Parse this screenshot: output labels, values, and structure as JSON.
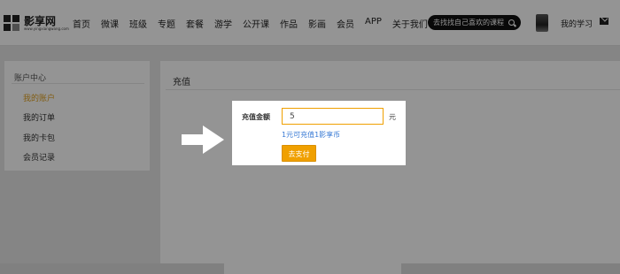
{
  "header": {
    "logo_text": "影享网",
    "logo_sub": "www.yingxiangwang.com",
    "nav": [
      "首页",
      "微课",
      "班级",
      "专题",
      "套餐",
      "游学",
      "公开课",
      "作品",
      "影画",
      "会员",
      "APP",
      "关于我们"
    ],
    "search_placeholder": "去找找自己喜欢的课程",
    "my_study": "我的学习"
  },
  "sidebar": {
    "title": "账户中心",
    "items": [
      {
        "label": "我的账户",
        "active": true
      },
      {
        "label": "我的订单",
        "active": false
      },
      {
        "label": "我的卡包",
        "active": false
      },
      {
        "label": "会员记录",
        "active": false
      }
    ]
  },
  "panel": {
    "title": "充值"
  },
  "modal": {
    "amount_label": "充值金额",
    "amount_value": "5",
    "unit": "元",
    "hint": "1元可充值1影享币",
    "pay_button": "去支付"
  },
  "colors": {
    "accent": "#f0a000",
    "link": "#3a7bd5",
    "active_item": "#e0a020"
  }
}
